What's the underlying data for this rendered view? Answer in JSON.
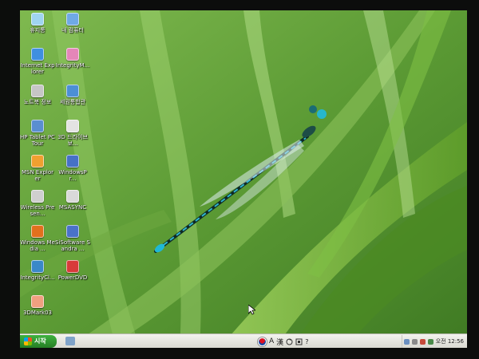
{
  "desktop": {
    "icons": [
      {
        "label": "휴지통",
        "icon": "recycle-bin-icon",
        "color": "#9fd4f0"
      },
      {
        "label": "내 컴퓨터",
        "icon": "my-computer-icon",
        "color": "#6fa9e6"
      },
      {
        "label": "Internet Explorer",
        "icon": "internet-explorer-icon",
        "color": "#3f8fe0"
      },
      {
        "label": "IntegrityM...",
        "icon": "integrity-monitor-icon",
        "color": "#e486b8"
      },
      {
        "label": "노트북 정보",
        "icon": "laptop-info-icon",
        "color": "#c6c6c6"
      },
      {
        "label": "세원통합관",
        "icon": "app-icon",
        "color": "#4c8fd6"
      },
      {
        "label": "HP Tablet PC Tour",
        "icon": "tablet-pc-tour-icon",
        "color": "#5a8ed0"
      },
      {
        "label": "3D 드라이브 보...",
        "icon": "3d-drive-guard-icon",
        "color": "#e3e3e3"
      },
      {
        "label": "MSN Explorer",
        "icon": "msn-explorer-icon",
        "color": "#f0a030"
      },
      {
        "label": "WindowsPr...",
        "icon": "windows-shortcut-icon",
        "color": "#4671c6"
      },
      {
        "label": "Wireless Presen...",
        "icon": "wireless-presentation-icon",
        "color": "#cfcfcf"
      },
      {
        "label": "MSASYNC",
        "icon": "msasync-icon",
        "color": "#d9d9d9"
      },
      {
        "label": "Windows Media ...",
        "icon": "windows-media-player-icon",
        "color": "#e2701d"
      },
      {
        "label": "SiSoftware Sandra ...",
        "icon": "sisoftware-sandra-icon",
        "color": "#4a72c9"
      },
      {
        "label": "IntegrityCl...",
        "icon": "integrity-client-icon",
        "color": "#3a88c8"
      },
      {
        "label": "PowerDVD",
        "icon": "powerdvd-icon",
        "color": "#d83a3a"
      },
      {
        "label": "3DMark03",
        "icon": "3dmark-icon",
        "color": "#f0a080"
      }
    ]
  },
  "taskbar": {
    "start_label": "시작",
    "quick_launch_icon": "show-desktop-icon",
    "ime": {
      "flag_icon": "korean-flag-icon",
      "mode_a": "A",
      "hanja": "漢",
      "icon2": "ime-toggle-icon",
      "icon3": "ime-pad-icon",
      "help": "?"
    },
    "tray": {
      "icons": [
        "network-icon",
        "volume-icon",
        "security-icon",
        "tablet-icon"
      ],
      "time": "오전 12:56"
    }
  },
  "colors": {
    "taskbar_bg": "#e6e6de",
    "start_green": "#2f9a2f",
    "wallpaper_green": "#5f9c39"
  }
}
